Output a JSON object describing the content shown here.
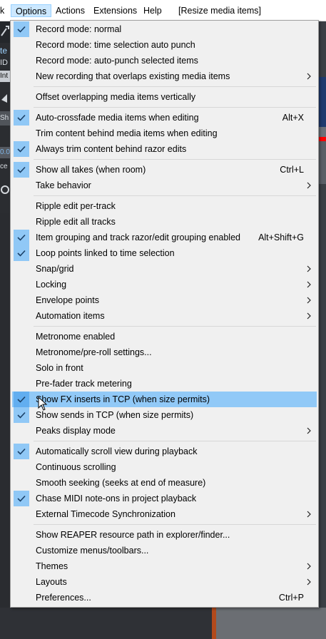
{
  "menubar": {
    "items": [
      {
        "label": "k"
      },
      {
        "label": "Options"
      },
      {
        "label": "Actions"
      },
      {
        "label": "Extensions"
      },
      {
        "label": "Help"
      },
      {
        "label": "[Resize media items]"
      }
    ]
  },
  "background": {
    "left_texts": [
      "te",
      "ID",
      "Int",
      "Sh",
      "0.0",
      "ce"
    ]
  },
  "menu": {
    "highlighted_index": 21,
    "items": [
      {
        "label": "Record mode: normal",
        "checked": true,
        "shortcut": "",
        "submenu": false
      },
      {
        "label": "Record mode: time selection auto punch",
        "checked": false,
        "shortcut": "",
        "submenu": false
      },
      {
        "label": "Record mode: auto-punch selected items",
        "checked": false,
        "shortcut": "",
        "submenu": false
      },
      {
        "label": "New recording that overlaps existing media items",
        "checked": false,
        "shortcut": "",
        "submenu": true
      },
      {
        "label": "Offset overlapping media items vertically",
        "checked": false,
        "shortcut": "",
        "submenu": false
      },
      {
        "label": "Auto-crossfade media items when editing",
        "checked": true,
        "shortcut": "Alt+X",
        "submenu": false
      },
      {
        "label": "Trim content behind media items when editing",
        "checked": false,
        "shortcut": "",
        "submenu": false
      },
      {
        "label": "Always trim content behind razor edits",
        "checked": true,
        "shortcut": "",
        "submenu": false
      },
      {
        "label": "Show all takes (when room)",
        "checked": true,
        "shortcut": "Ctrl+L",
        "submenu": false
      },
      {
        "label": "Take behavior",
        "checked": false,
        "shortcut": "",
        "submenu": true
      },
      {
        "label": "Ripple edit per-track",
        "checked": false,
        "shortcut": "",
        "submenu": false
      },
      {
        "label": "Ripple edit all tracks",
        "checked": false,
        "shortcut": "",
        "submenu": false
      },
      {
        "label": "Item grouping and track razor/edit grouping enabled",
        "checked": true,
        "shortcut": "Alt+Shift+G",
        "submenu": false
      },
      {
        "label": "Loop points linked to time selection",
        "checked": true,
        "shortcut": "",
        "submenu": false
      },
      {
        "label": "Snap/grid",
        "checked": false,
        "shortcut": "",
        "submenu": true
      },
      {
        "label": "Locking",
        "checked": false,
        "shortcut": "",
        "submenu": true
      },
      {
        "label": "Envelope points",
        "checked": false,
        "shortcut": "",
        "submenu": true
      },
      {
        "label": "Automation items",
        "checked": false,
        "shortcut": "",
        "submenu": true
      },
      {
        "label": "Metronome enabled",
        "checked": false,
        "shortcut": "",
        "submenu": false
      },
      {
        "label": "Metronome/pre-roll settings...",
        "checked": false,
        "shortcut": "",
        "submenu": false
      },
      {
        "label": "Solo in front",
        "checked": false,
        "shortcut": "",
        "submenu": false
      },
      {
        "label": "Pre-fader track metering",
        "checked": false,
        "shortcut": "",
        "submenu": false
      },
      {
        "label": "Show FX inserts in TCP (when size permits)",
        "checked": true,
        "shortcut": "",
        "submenu": false
      },
      {
        "label": "Show sends in TCP (when size permits)",
        "checked": true,
        "shortcut": "",
        "submenu": false
      },
      {
        "label": "Peaks display mode",
        "checked": false,
        "shortcut": "",
        "submenu": true
      },
      {
        "label": "Automatically scroll view during playback",
        "checked": true,
        "shortcut": "",
        "submenu": false
      },
      {
        "label": "Continuous scrolling",
        "checked": false,
        "shortcut": "",
        "submenu": false
      },
      {
        "label": "Smooth seeking (seeks at end of measure)",
        "checked": false,
        "shortcut": "",
        "submenu": false
      },
      {
        "label": "Chase MIDI note-ons in project playback",
        "checked": true,
        "shortcut": "",
        "submenu": false
      },
      {
        "label": "External Timecode Synchronization",
        "checked": false,
        "shortcut": "",
        "submenu": true
      },
      {
        "label": "Show REAPER resource path in explorer/finder...",
        "checked": false,
        "shortcut": "",
        "submenu": false
      },
      {
        "label": "Customize menus/toolbars...",
        "checked": false,
        "shortcut": "",
        "submenu": false
      },
      {
        "label": "Themes",
        "checked": false,
        "shortcut": "",
        "submenu": true
      },
      {
        "label": "Layouts",
        "checked": false,
        "shortcut": "",
        "submenu": true
      },
      {
        "label": "Preferences...",
        "checked": false,
        "shortcut": "Ctrl+P",
        "submenu": false
      }
    ]
  },
  "colors": {
    "menu_bg": "#f0f0f0",
    "highlight": "#91c9f7",
    "check_bg": "#90c8f6",
    "check_mark": "#1a3f66",
    "menubar_active": "#cce8ff"
  }
}
